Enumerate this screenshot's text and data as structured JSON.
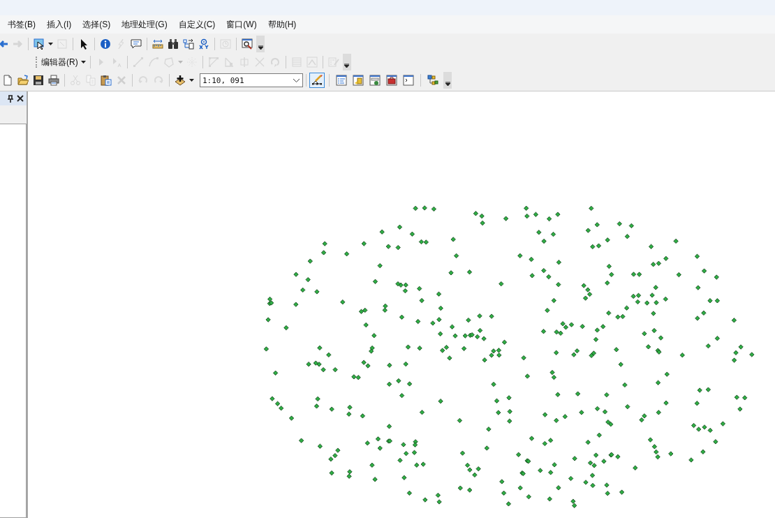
{
  "menu_bar": {
    "items": [
      "书签(B)",
      "插入(I)",
      "选择(S)",
      "地理处理(G)",
      "自定义(C)",
      "窗口(W)",
      "帮助(H)"
    ]
  },
  "tools_toolbar": {
    "buttons": [
      {
        "disabled": false
      },
      {
        "disabled": true
      },
      {
        "disabled": false
      },
      {
        "disabled": true
      },
      {
        "disabled": false
      },
      {
        "disabled": false
      },
      {
        "disabled": true
      },
      {
        "disabled": false
      },
      {
        "disabled": false
      },
      {
        "disabled": false
      },
      {
        "disabled": false
      },
      {
        "disabled": false
      },
      {
        "disabled": true
      },
      {
        "disabled": false
      }
    ]
  },
  "editor_toolbar": {
    "menu_label": "编辑器(R)",
    "buttons": [
      {
        "disabled": true
      },
      {
        "disabled": true
      },
      {
        "disabled": true
      },
      {
        "disabled": true
      },
      {
        "disabled": true
      },
      {
        "disabled": true
      },
      {
        "disabled": true
      },
      {
        "disabled": true
      },
      {
        "disabled": true
      },
      {
        "disabled": true
      },
      {
        "disabled": true
      },
      {
        "disabled": true
      },
      {
        "disabled": true
      },
      {
        "disabled": true
      }
    ]
  },
  "standard_toolbar": {
    "scale": "1:10, 091",
    "buttons": [
      {
        "disabled": false,
        "selected": false
      },
      {
        "disabled": false,
        "selected": false
      },
      {
        "disabled": false,
        "selected": false
      },
      {
        "disabled": false,
        "selected": false
      },
      {
        "disabled": true,
        "selected": false
      },
      {
        "disabled": true,
        "selected": false
      },
      {
        "disabled": false,
        "selected": false
      },
      {
        "disabled": true,
        "selected": false
      },
      {
        "disabled": true,
        "selected": false
      },
      {
        "disabled": true,
        "selected": false
      },
      {
        "disabled": false,
        "selected": false
      },
      {
        "disabled": false,
        "selected": true
      },
      {
        "disabled": false,
        "selected": false
      },
      {
        "disabled": false,
        "selected": false
      },
      {
        "disabled": false,
        "selected": false
      },
      {
        "disabled": false,
        "selected": false
      },
      {
        "disabled": false,
        "selected": false
      },
      {
        "disabled": false,
        "selected": false
      }
    ]
  }
}
